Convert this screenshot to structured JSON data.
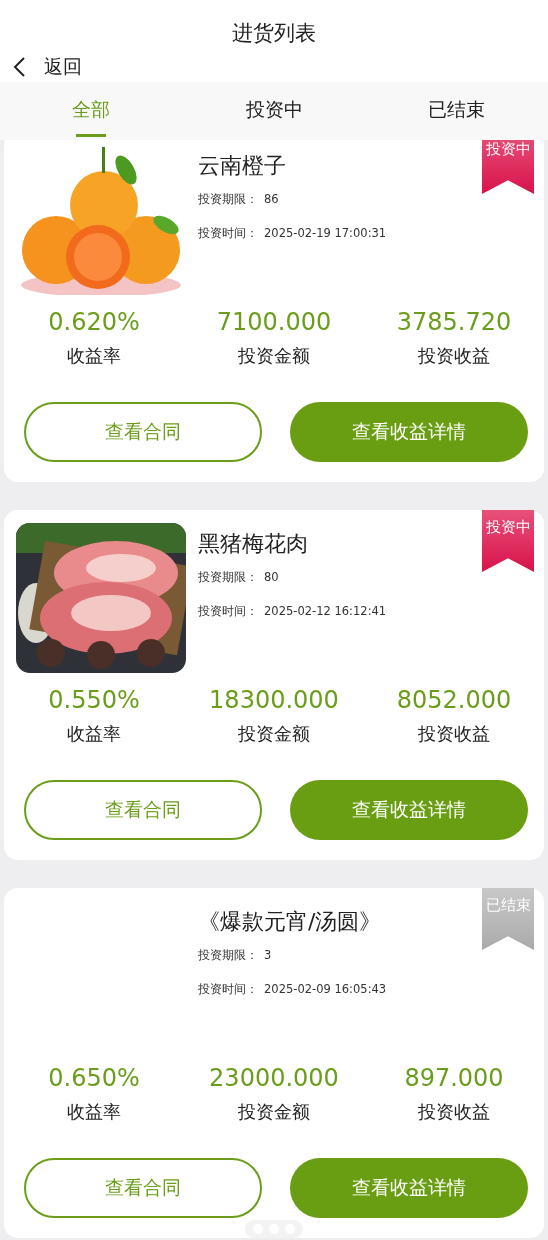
{
  "header": {
    "title": "进货列表",
    "back_label": "返回"
  },
  "tabs": [
    {
      "label": "全部",
      "selected": true
    },
    {
      "label": "投资中",
      "selected": false
    },
    {
      "label": "已结束",
      "selected": false
    }
  ],
  "items": [
    {
      "name": "云南橙子",
      "status": {
        "kind": "investing",
        "label": "投资中"
      },
      "period_label": "投资期限：",
      "period": "86",
      "time_label": "投资时间：",
      "time": "2025-02-19 17:00:31",
      "stats": [
        {
          "value": "0.620%",
          "label": "收益率"
        },
        {
          "value": "7100.000",
          "label": "投资金额"
        },
        {
          "value": "3785.720",
          "label": "投资收益"
        }
      ],
      "contract_button": "查看合同",
      "detail_button": "查看收益详情"
    },
    {
      "name": "黑猪梅花肉",
      "status": {
        "kind": "investing",
        "label": "投资中"
      },
      "period_label": "投资期限：",
      "period": "80",
      "time_label": "投资时间：",
      "time": "2025-02-12 16:12:41",
      "stats": [
        {
          "value": "0.550%",
          "label": "收益率"
        },
        {
          "value": "18300.000",
          "label": "投资金额"
        },
        {
          "value": "8052.000",
          "label": "投资收益"
        }
      ],
      "contract_button": "查看合同",
      "detail_button": "查看收益详情"
    },
    {
      "name": "《爆款元宵/汤圆》",
      "status": {
        "kind": "ended",
        "label": "已结束"
      },
      "period_label": "投资期限：",
      "period": "3",
      "time_label": "投资时间：",
      "time": "2025-02-09 16:05:43",
      "stats": [
        {
          "value": "0.650%",
          "label": "收益率"
        },
        {
          "value": "23000.000",
          "label": "投资金额"
        },
        {
          "value": "897.000",
          "label": "投资收益"
        }
      ],
      "contract_button": "查看合同",
      "detail_button": "查看收益详情"
    }
  ]
}
